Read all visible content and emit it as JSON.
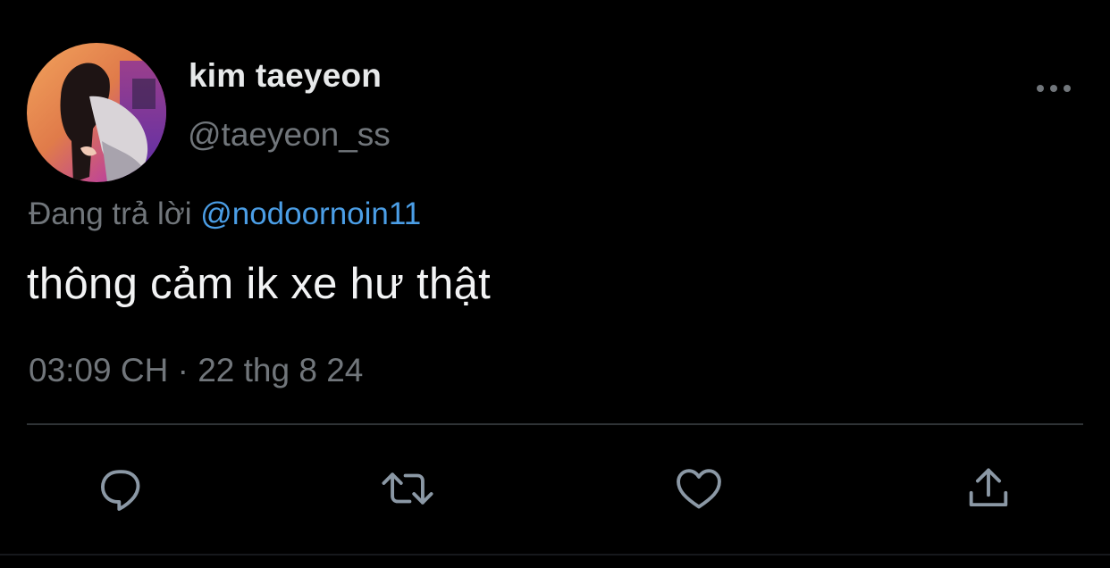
{
  "tweet": {
    "author": {
      "display_name": "kim taeyeon",
      "handle": "@taeyeon_ss",
      "avatar_icon": "avatar"
    },
    "replying": {
      "prefix": "Đang trả lời",
      "mention": "@nodoornoin11"
    },
    "text": "thông cảm ik xe hư thật",
    "timestamp": "03:09 CH · 22 thg 8 24"
  },
  "actions": {
    "reply": "reply-icon",
    "retweet": "retweet-icon",
    "like": "heart-icon",
    "share": "share-icon",
    "more": "more-icon"
  },
  "colors": {
    "background": "#000000",
    "primary_text": "#e7e9ea",
    "secondary_text": "#71767b",
    "link": "#4b9ee6",
    "divider": "#2f3336"
  }
}
